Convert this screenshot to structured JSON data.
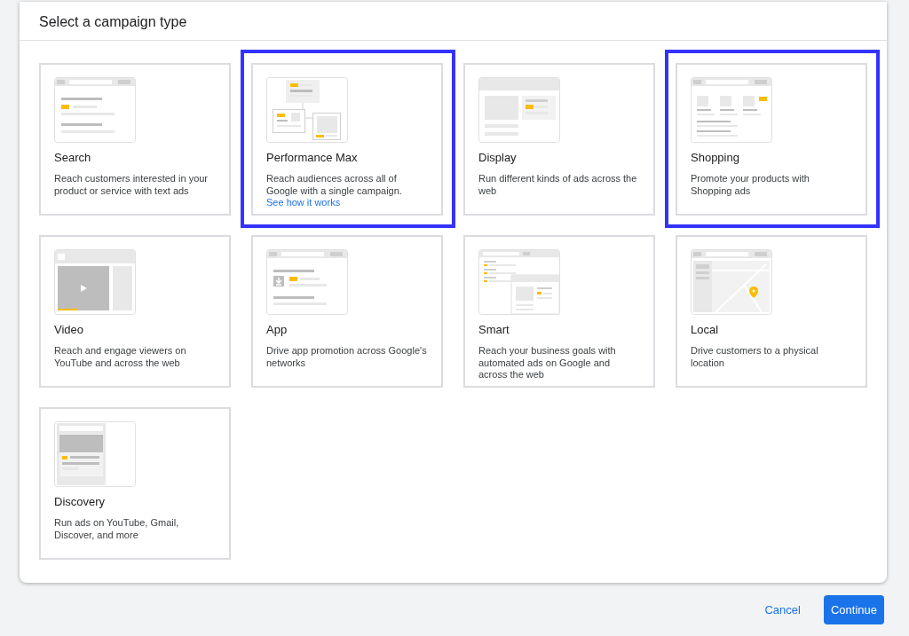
{
  "dialog": {
    "title": "Select a campaign type"
  },
  "cards": [
    {
      "kind": "search",
      "title": "Search",
      "description": "Reach customers interested in your product or service with text ads",
      "highlighted": false
    },
    {
      "kind": "performance",
      "title": "Performance Max",
      "description": "Reach audiences across all of Google with a single campaign.",
      "link": "See how it works",
      "highlighted": true
    },
    {
      "kind": "display",
      "title": "Display",
      "description": "Run different kinds of ads across the web",
      "highlighted": false
    },
    {
      "kind": "shopping",
      "title": "Shopping",
      "description": "Promote your products with Shopping ads",
      "highlighted": true
    },
    {
      "kind": "video",
      "title": "Video",
      "description": "Reach and engage viewers on YouTube and across the web",
      "highlighted": false
    },
    {
      "kind": "app",
      "title": "App",
      "description": "Drive app promotion across Google's networks",
      "highlighted": false
    },
    {
      "kind": "smart",
      "title": "Smart",
      "description": "Reach your business goals with automated ads on Google and across the web",
      "highlighted": false
    },
    {
      "kind": "local",
      "title": "Local",
      "description": "Drive customers to a physical location",
      "highlighted": false
    },
    {
      "kind": "discovery",
      "title": "Discovery",
      "description": "Run ads on YouTube, Gmail, Discover, and more",
      "highlighted": false
    }
  ],
  "buttons": [
    {
      "kind": "text",
      "label": "Cancel"
    },
    {
      "kind": "primary",
      "label": "Continue"
    }
  ]
}
